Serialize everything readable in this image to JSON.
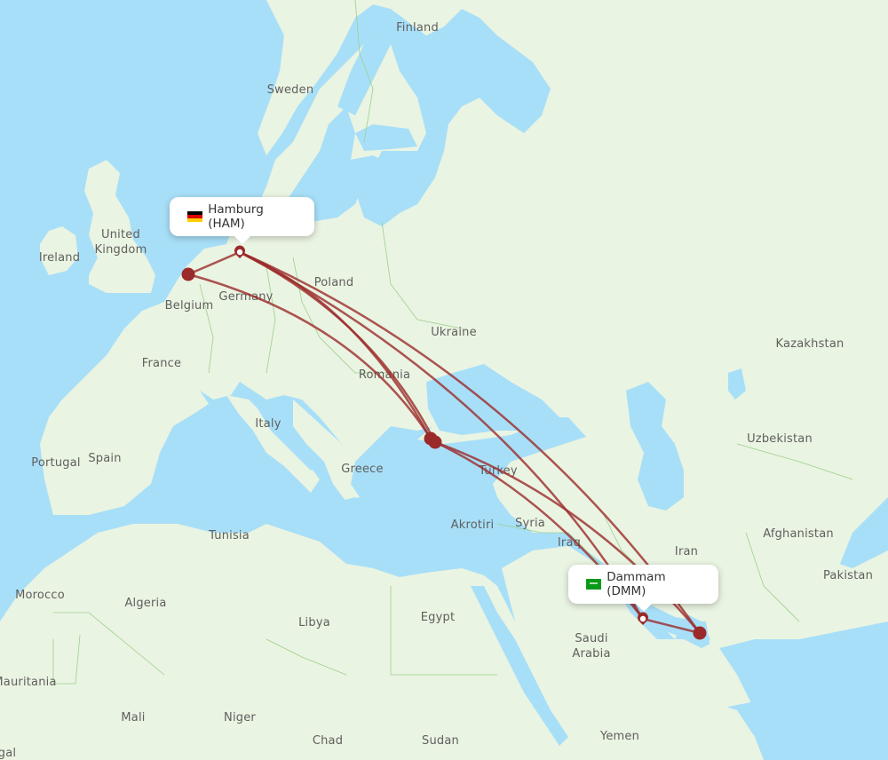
{
  "map": {
    "colors": {
      "water": "#a8dff8",
      "land": "#eaf4e2",
      "border": "#9cd08c",
      "route": "#9b2a2a",
      "airport": "#9b2a2a"
    },
    "country_labels": [
      {
        "name": "Finland"
      },
      {
        "name": "Sweden"
      },
      {
        "name": "United"
      },
      {
        "name": "Kingdom"
      },
      {
        "name": "Ireland"
      },
      {
        "name": "Poland"
      },
      {
        "name": "Germany"
      },
      {
        "name": "Belgium"
      },
      {
        "name": "Ukraine"
      },
      {
        "name": "France"
      },
      {
        "name": "Romania"
      },
      {
        "name": "Kazakhstan"
      },
      {
        "name": "Italy"
      },
      {
        "name": "Uzbekistan"
      },
      {
        "name": "Portugal"
      },
      {
        "name": "Spain"
      },
      {
        "name": "Greece"
      },
      {
        "name": "Turkey"
      },
      {
        "name": "Akrotiri"
      },
      {
        "name": "Syria"
      },
      {
        "name": "Tunisia"
      },
      {
        "name": "Iraq"
      },
      {
        "name": "Afghanistan"
      },
      {
        "name": "Iran"
      },
      {
        "name": "Pakistan"
      },
      {
        "name": "Morocco"
      },
      {
        "name": "Algeria"
      },
      {
        "name": "Libya"
      },
      {
        "name": "Egypt"
      },
      {
        "name": "Saudi"
      },
      {
        "name": "Arabia"
      },
      {
        "name": "Mauritania"
      },
      {
        "name": "Mali"
      },
      {
        "name": "Niger"
      },
      {
        "name": "Chad"
      },
      {
        "name": "Sudan"
      },
      {
        "name": "Yemen"
      },
      {
        "name": "gal"
      }
    ],
    "origin": {
      "city": "Hamburg",
      "code": "HAM",
      "label": "Hamburg (HAM)",
      "flag": "germany-flag"
    },
    "destination": {
      "city": "Dammam",
      "code": "DMM",
      "label": "Dammam (DMM)",
      "flag": "saudi-arabia-flag"
    },
    "stopovers": [
      {
        "name": "amsterdam-stop"
      },
      {
        "name": "istanbul-stop-1"
      },
      {
        "name": "istanbul-stop-2"
      },
      {
        "name": "dubai-stop"
      }
    ],
    "routes": [
      {
        "from": "HAM",
        "to": "DMM",
        "via": "direct"
      },
      {
        "from": "HAM",
        "to": "istanbul"
      },
      {
        "from": "HAM",
        "to": "dubai"
      },
      {
        "from": "amsterdam",
        "to": "HAM"
      },
      {
        "from": "amsterdam",
        "to": "istanbul"
      },
      {
        "from": "istanbul",
        "to": "DMM"
      },
      {
        "from": "istanbul",
        "to": "dubai"
      },
      {
        "from": "DMM",
        "to": "dubai"
      }
    ]
  }
}
